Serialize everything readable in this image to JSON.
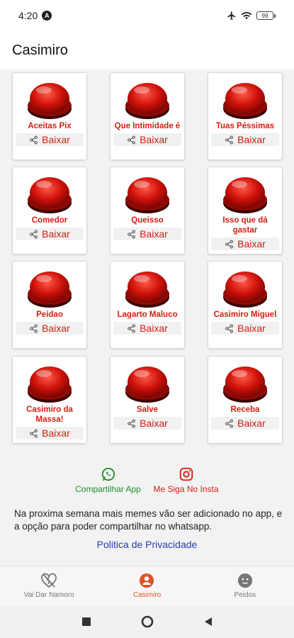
{
  "status_bar": {
    "time": "4:20",
    "badge_letter": "A",
    "battery": "99"
  },
  "app_bar": {
    "title": "Casimiro"
  },
  "share_label": "Baixar",
  "sounds": [
    {
      "label": "Aceitas Pix"
    },
    {
      "label": "Que Intimidade é"
    },
    {
      "label": "Tuas Péssimas"
    },
    {
      "label": "Comedor"
    },
    {
      "label": "Queisso"
    },
    {
      "label": "Isso que dá gastar"
    },
    {
      "label": "Peidao"
    },
    {
      "label": "Lagarto Maluco"
    },
    {
      "label": "Casimiro Miguel"
    },
    {
      "label": "Casimiro da Massa!"
    },
    {
      "label": "Salve"
    },
    {
      "label": "Receba"
    }
  ],
  "links": {
    "share_app": "Compartilhar App",
    "follow_insta": "Me Siga No Insta"
  },
  "notice": "Na proxima semana mais memes vão ser adicionado no app, e a opção para poder compartilhar no whatsapp.",
  "privacy_link": "Politica de Privacidade",
  "bottom_nav": {
    "items": [
      {
        "label": "Vai Dar Namoro",
        "icon": "broken-heart-icon",
        "active": false
      },
      {
        "label": "Casimiro",
        "icon": "person-icon",
        "active": true
      },
      {
        "label": "Peidos",
        "icon": "face-icon",
        "active": false
      }
    ]
  },
  "colors": {
    "accent_red": "#d51d12",
    "whatsapp_green": "#1f8f2a",
    "link_blue": "#2a3ab0",
    "active_nav": "#e0532c"
  }
}
